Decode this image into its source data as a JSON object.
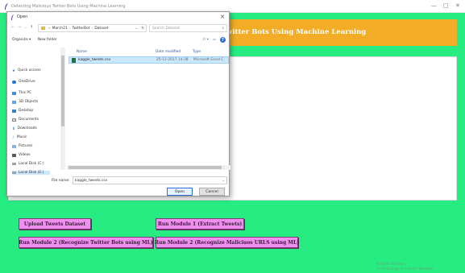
{
  "window": {
    "title": "Detecting Malicious Twitter Bots Using Machine Learning",
    "minimize": "—",
    "maximize": "□",
    "close": "✕"
  },
  "app": {
    "heading": "witter Bots Using Machine Learning",
    "buttons": {
      "upload": "Upload Tweets Dataset",
      "module1": "Run Module 1 (Extract Tweets)",
      "module2": "Run Module 2 (Recognize Twitter Bots using ML)",
      "module2b": "Run Module 2 (Recognize Maliciuos URLS using ML)"
    },
    "activate_line1": "Activate Windows",
    "activate_line2": "Go to Settings to activate Windows."
  },
  "dialog": {
    "title": "Open",
    "close": "✕",
    "path": [
      "March21",
      "TwitterBot",
      "Dataset"
    ],
    "search_placeholder": "Search Dataset",
    "organize": "Organize ▾",
    "new_folder": "New folder",
    "help": "?",
    "nav_items": [
      {
        "label": "Quick access",
        "icon": "star-icon"
      },
      {
        "label": "OneDrive",
        "icon": "cloud-icon"
      },
      {
        "label": "This PC",
        "icon": "computer-icon"
      },
      {
        "label": "3D Objects",
        "icon": "cube-icon"
      },
      {
        "label": "Desktop",
        "icon": "desktop-icon"
      },
      {
        "label": "Documents",
        "icon": "documents-icon"
      },
      {
        "label": "Downloads",
        "icon": "download-icon"
      },
      {
        "label": "Music",
        "icon": "music-icon"
      },
      {
        "label": "Pictures",
        "icon": "pictures-icon"
      },
      {
        "label": "Videos",
        "icon": "videos-icon"
      },
      {
        "label": "Local Disk (C:)",
        "icon": "disk-icon"
      },
      {
        "label": "Local Disk (E:)",
        "icon": "disk-icon"
      }
    ],
    "columns": {
      "name": "Name",
      "date": "Date modified",
      "type": "Type"
    },
    "files": [
      {
        "name": "kaggle_tweets.csv",
        "date": "25-12-2017 14:38",
        "type": "Microsoft Excel C"
      }
    ],
    "file_name_label": "File name:",
    "file_name_value": "kaggle_tweets.csv",
    "open_button": "Open",
    "cancel_button": "Cancel"
  },
  "colors": {
    "app_background": "#27ec82",
    "heading_background": "#f3ac26",
    "button_background": "#f08ff0",
    "selection": "#cce8ff"
  }
}
